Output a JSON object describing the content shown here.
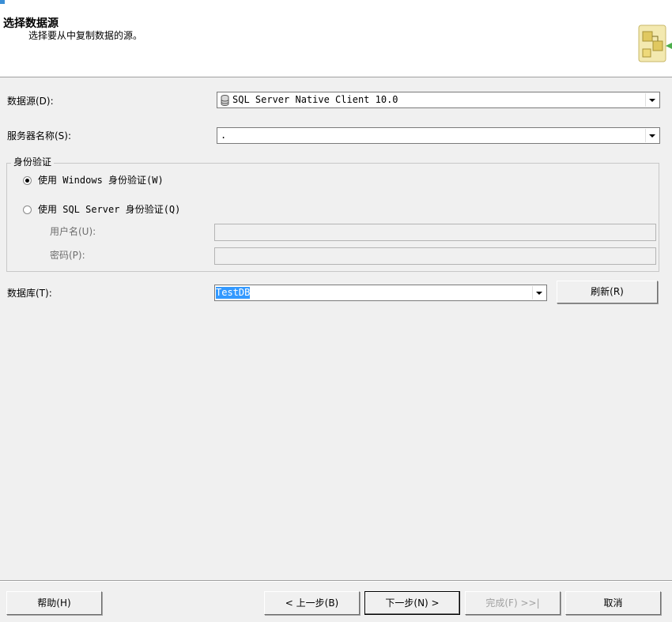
{
  "header": {
    "title": "选择数据源",
    "subtitle": "选择要从中复制数据的源。"
  },
  "form": {
    "datasource_label": "数据源(D):",
    "datasource_value": "SQL Server Native Client 10.0",
    "server_label": "服务器名称(S):",
    "server_value": ".",
    "auth": {
      "group_label": "身份验证",
      "windows_label": "使用 Windows 身份验证(W)",
      "sql_label": "使用 SQL Server 身份验证(Q)",
      "username_label": "用户名(U):",
      "username_value": "",
      "password_label": "密码(P):",
      "password_value": "",
      "selected": "windows"
    },
    "database_label": "数据库(T):",
    "database_value": "TestDB",
    "refresh_label": "刷新(R)"
  },
  "footer": {
    "help_label": "帮助(H)",
    "back_label": "< 上一步(B)",
    "next_label": "下一步(N) >",
    "finish_label": "完成(F) >>|",
    "cancel_label": "取消"
  },
  "icons": {
    "datasource": "database-icon",
    "wizard": "wizard-graphic-icon"
  }
}
